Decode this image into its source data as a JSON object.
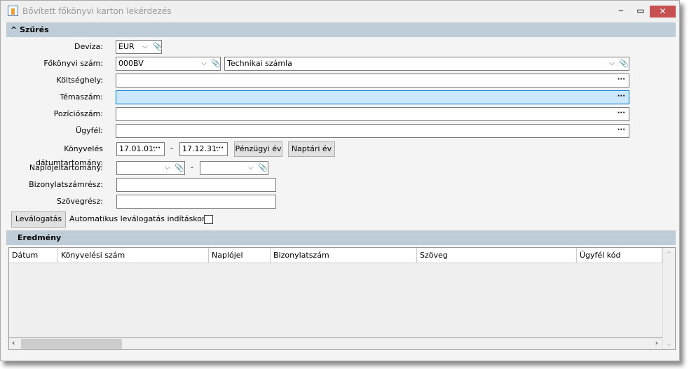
{
  "window": {
    "title": "Bővített főkönyvi karton lekérdezés",
    "minimize": "‒",
    "maximize": "▭",
    "close": "✕"
  },
  "filter": {
    "header": "Szűrés",
    "collapse_icon": "^",
    "deviza": {
      "label": "Deviza:",
      "value": "EUR"
    },
    "fokonyvi": {
      "label": "Főkönyvi szám:",
      "value": "000BV",
      "name_value": "Technikai számla"
    },
    "koltseghely": {
      "label": "Költséghely:",
      "value": ""
    },
    "temaszam": {
      "label": "Témaszám:",
      "value": ""
    },
    "pozicioszam": {
      "label": "Pozíciószám:",
      "value": ""
    },
    "ugyfel": {
      "label": "Ügyfél:",
      "value": ""
    },
    "datum": {
      "label": "Könyvelés dátumtartomány:",
      "from": "17.01.01.",
      "to": "17.12.31.",
      "sep": "-",
      "fiscal_button": "Pénzügyi év",
      "calendar_button": "Naptári év"
    },
    "naplojel": {
      "label": "Naplójeltartomány:",
      "from": "",
      "to": "",
      "sep": "-"
    },
    "bizonylat": {
      "label": "Bizonylatszámrész:",
      "value": ""
    },
    "szoveg": {
      "label": "Szövegrész:",
      "value": ""
    },
    "filter_button": "Leválogatás",
    "auto_label": "Automatikus leválogatás indításkor:",
    "auto_checked": false
  },
  "result": {
    "header": "Eredmény",
    "columns": [
      "Dátum",
      "Könyvelési szám",
      "Naplójel",
      "Bizonylatszám",
      "Szöveg",
      "Ügyfél kód"
    ],
    "rows": []
  },
  "icons": {
    "dots": "···",
    "chevron": "﹀",
    "clip": "⧉"
  }
}
